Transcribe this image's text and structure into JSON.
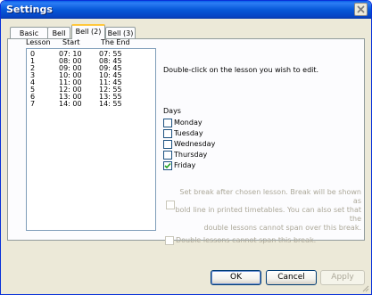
{
  "window": {
    "title": "Settings"
  },
  "tabs": [
    {
      "label": "Basic data"
    },
    {
      "label": "Bell"
    },
    {
      "label": "Bell (2)"
    },
    {
      "label": "Bell (3)"
    }
  ],
  "lessons": {
    "headers": {
      "lesson": "Lesson",
      "start": "Start",
      "end": "The End"
    },
    "rows": [
      {
        "lesson": "0",
        "start": "07: 10",
        "end": "07: 55"
      },
      {
        "lesson": "1",
        "start": "08: 00",
        "end": "08: 45"
      },
      {
        "lesson": "2",
        "start": "09: 00",
        "end": "09: 45"
      },
      {
        "lesson": "3",
        "start": "10: 00",
        "end": "10: 45"
      },
      {
        "lesson": "4",
        "start": "11: 00",
        "end": "11: 45"
      },
      {
        "lesson": "5",
        "start": "12: 00",
        "end": "12: 55"
      },
      {
        "lesson": "6",
        "start": "13: 00",
        "end": "13: 55"
      },
      {
        "lesson": "7",
        "start": "14: 00",
        "end": "14: 55"
      }
    ]
  },
  "instruction": "Double-click on the lesson you wish to edit.",
  "days": {
    "label": "Days",
    "items": [
      {
        "label": "Monday",
        "checked": false
      },
      {
        "label": "Tuesday",
        "checked": false
      },
      {
        "label": "Wednesday",
        "checked": false
      },
      {
        "label": "Thursday",
        "checked": false
      },
      {
        "label": "Friday",
        "checked": true
      }
    ]
  },
  "break_option": {
    "line1": "Set break after chosen lesson. Break will be shown as",
    "line2": "bold line in printed timetables. You can also set that the",
    "line3": "double lessons cannot span over this break.",
    "checked": false
  },
  "double_option": {
    "label": "Double lessons cannot span this break.",
    "checked": false
  },
  "buttons": {
    "ok": "OK",
    "cancel": "Cancel",
    "apply": "Apply"
  },
  "colors": {
    "titlebar": "#0758d8",
    "tab_highlight": "#ffc83c",
    "disabled_text": "#aca899",
    "check": "#21a121"
  }
}
